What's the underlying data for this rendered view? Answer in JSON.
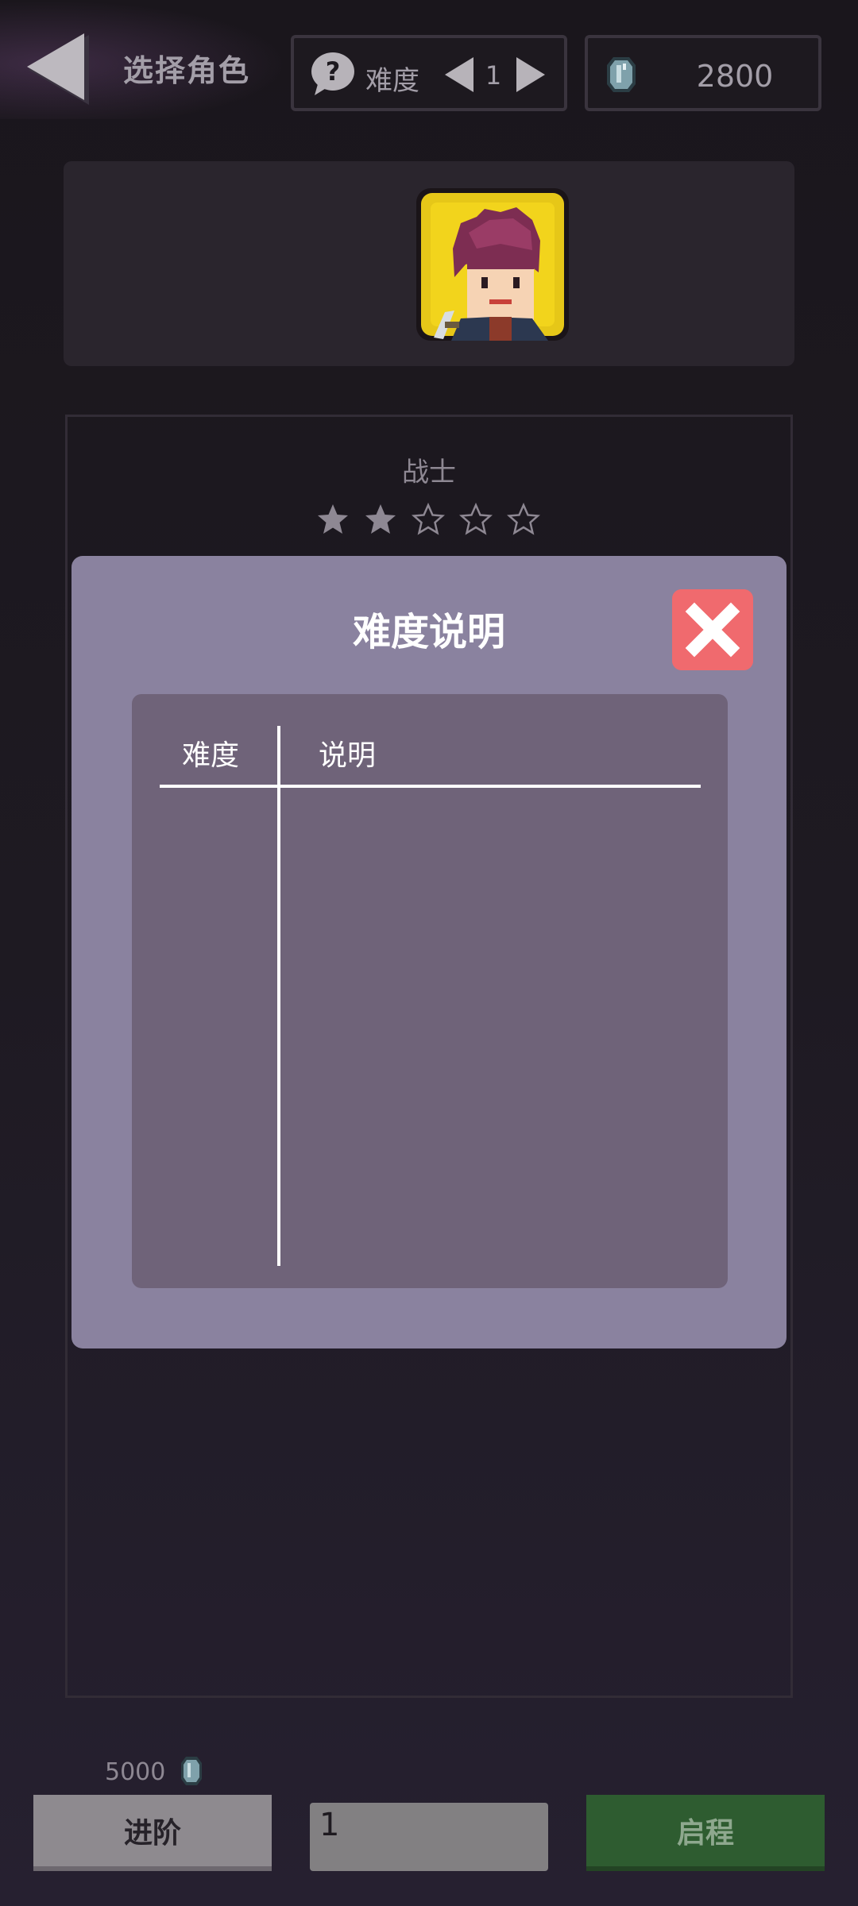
{
  "header": {
    "title": "选择角色",
    "difficulty_label": "难度",
    "difficulty_value": "1",
    "gems": "2800"
  },
  "character": {
    "name": "战士",
    "rating": 2,
    "rating_max": 5
  },
  "modal": {
    "title": "难度说明",
    "columns": [
      "难度",
      "说明"
    ]
  },
  "footer": {
    "advance_cost": "5000",
    "advance_label": "进阶",
    "level_input_value": "1",
    "start_label": "启程"
  },
  "colors": {
    "modal_bg": "#8a829f",
    "table_bg": "#6f6379",
    "close_btn": "#f06a6e",
    "start_btn": "#2e5c30",
    "advance_btn": "#8e8a8f"
  }
}
